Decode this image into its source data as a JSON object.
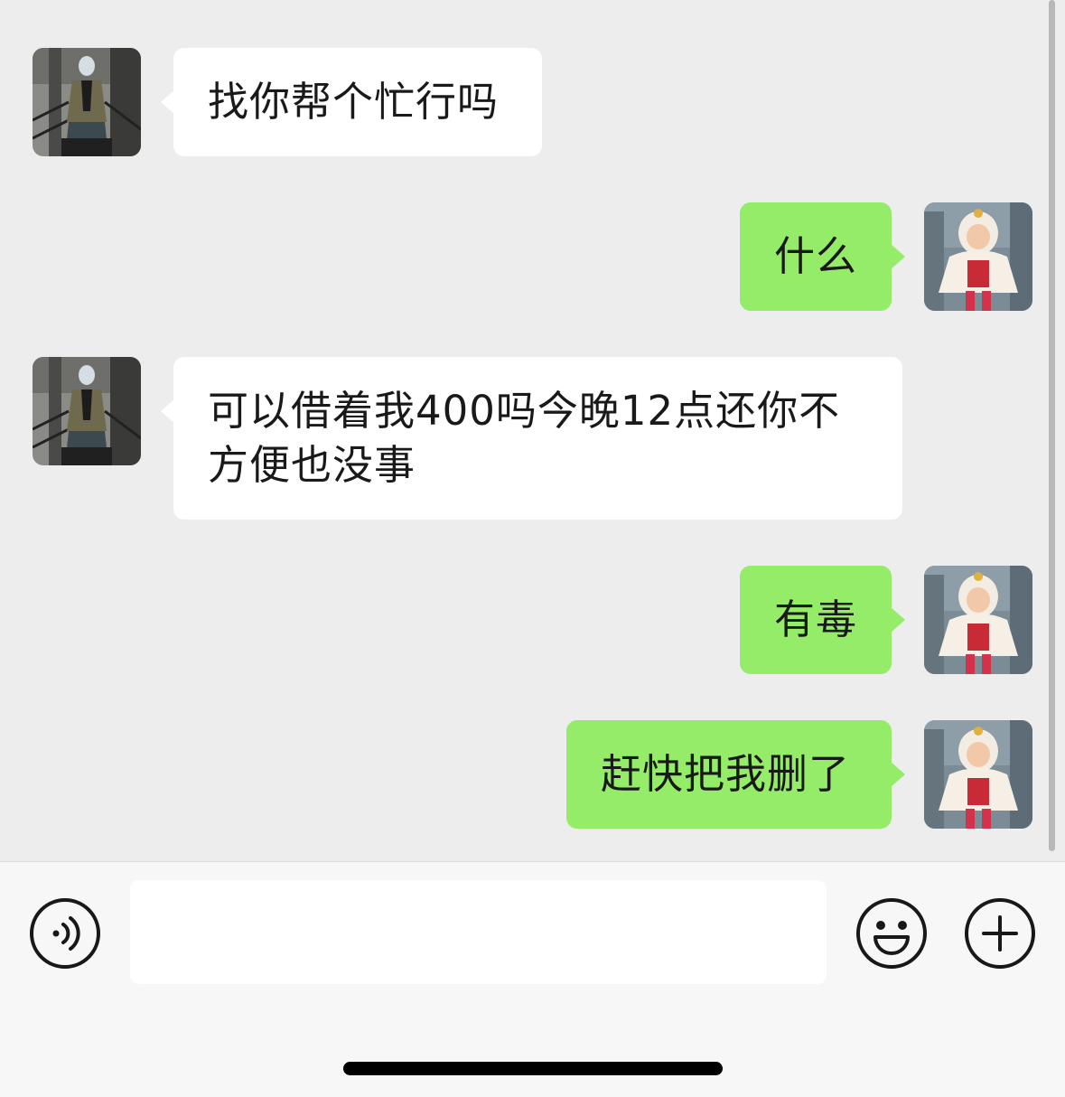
{
  "colors": {
    "background": "#ededed",
    "incoming_bubble": "#ffffff",
    "outgoing_bubble": "#95ec69",
    "text": "#191919",
    "input_bar": "#f7f7f7"
  },
  "messages": [
    {
      "side": "in",
      "text": "找你帮个忙行吗",
      "avatar": "contact-avatar"
    },
    {
      "side": "out",
      "text": "什么",
      "avatar": "self-avatar"
    },
    {
      "side": "in",
      "text": "可以借着我400吗今晚12点还你不方便也没事",
      "avatar": "contact-avatar"
    },
    {
      "side": "out",
      "text": "有毒",
      "avatar": "self-avatar"
    },
    {
      "side": "out",
      "text": "赶快把我删了",
      "avatar": "self-avatar"
    }
  ],
  "input_bar": {
    "voice_icon": "voice-icon",
    "input_value": "",
    "emoji_icon": "emoji-icon",
    "plus_icon": "plus-icon"
  }
}
